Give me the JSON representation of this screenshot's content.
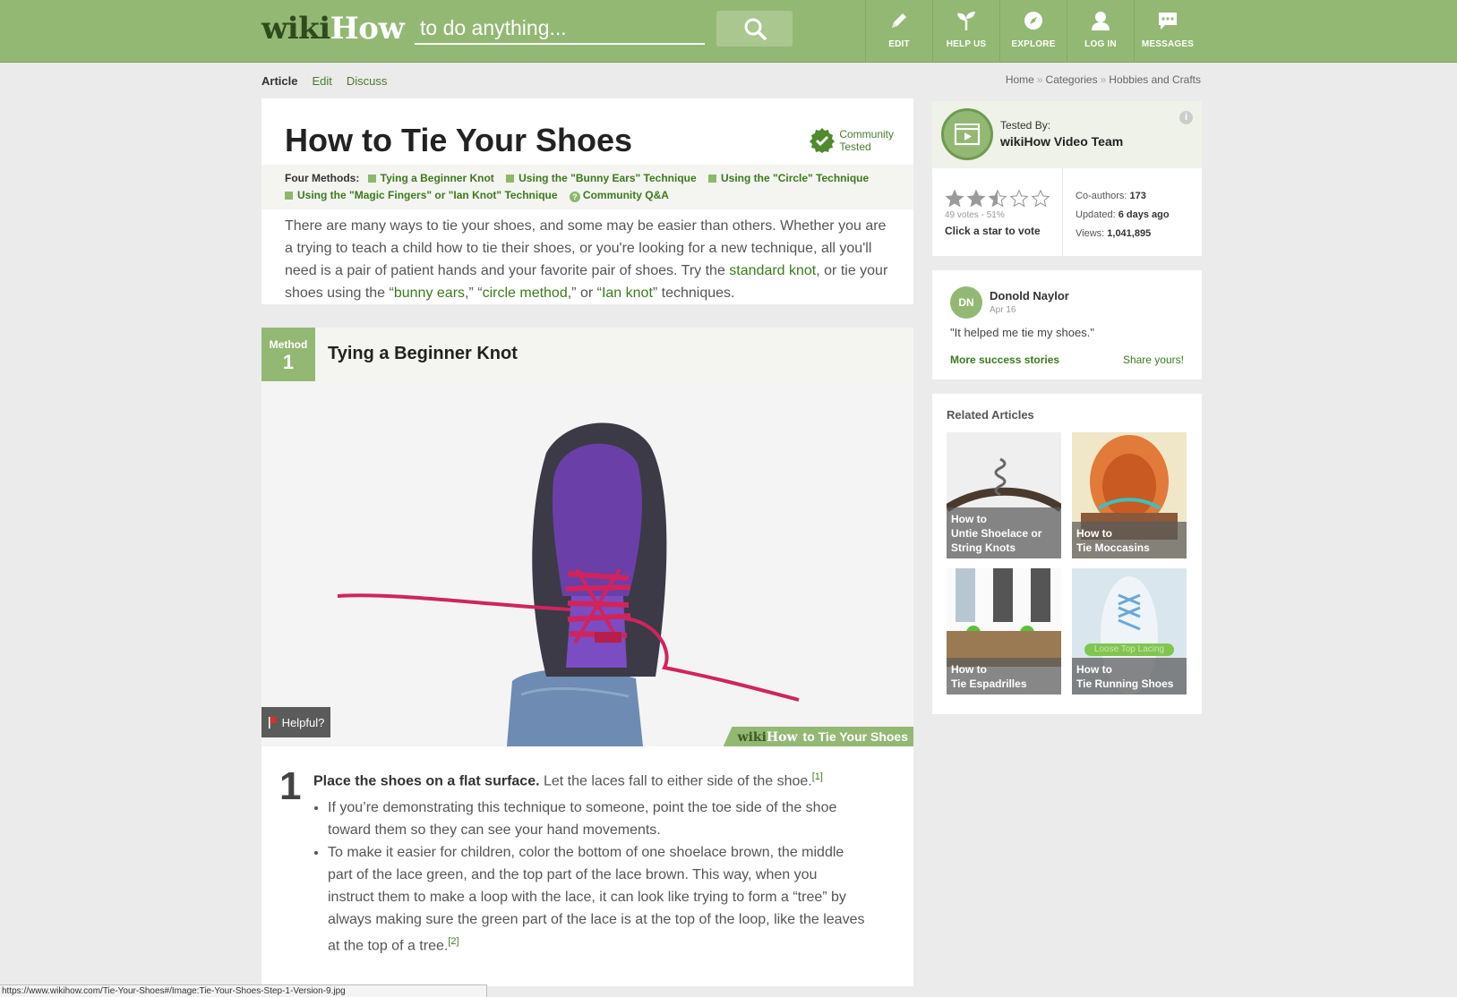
{
  "header": {
    "logo_wiki": "wiki",
    "logo_how": "How",
    "search_placeholder": "to do anything...",
    "nav": [
      {
        "label": "EDIT",
        "icon": "pencil-icon"
      },
      {
        "label": "HELP US",
        "icon": "sprout-icon"
      },
      {
        "label": "EXPLORE",
        "icon": "compass-icon"
      },
      {
        "label": "LOG IN",
        "icon": "user-icon"
      },
      {
        "label": "MESSAGES",
        "icon": "chat-bubble-icon"
      }
    ]
  },
  "tabs": [
    "Article",
    "Edit",
    "Discuss"
  ],
  "breadcrumbs": [
    "Home",
    "Categories",
    "Hobbies and Crafts"
  ],
  "article": {
    "title": "How to Tie Your Shoes",
    "badge_line1": "Community",
    "badge_line2": "Tested",
    "methods_lead": "Four Methods:",
    "methods": [
      "Tying a Beginner Knot",
      "Using the \"Bunny Ears\" Technique",
      "Using the \"Circle\" Technique",
      "Using the \"Magic Fingers\" or \"Ian Knot\" Technique"
    ],
    "community_qa": "Community Q&A",
    "intro_1": "There are many ways to tie your shoes, and some may be easier than others. Whether you are a trying to teach a child how to tie their shoes, or you're looking for a new technique, all you'll need is a pair of patient hands and your favorite pair of shoes. Try the ",
    "intro_link_1": "standard knot",
    "intro_2": ", or tie your shoes using the “",
    "intro_link_2": "bunny ears",
    "intro_3": ",” “",
    "intro_link_3": "circle method",
    "intro_4": ",” or “",
    "intro_link_4": "Ian knot",
    "intro_5": "” techniques."
  },
  "method": {
    "word": "Method",
    "number": "1",
    "title": "Tying a Beginner Knot"
  },
  "step_image": {
    "helpful": "Helpful?",
    "wm_wiki": "wiki",
    "wm_how": "How",
    "wm_title": "to Tie Your Shoes"
  },
  "step": {
    "number": "1",
    "bold": "Place the shoes on a flat surface.",
    "text": " Let the laces fall to either side of the shoe.",
    "ref1": "[1]",
    "bullet1": "If you’re demonstrating this technique to someone, point the toe side of the shoe toward them so they can see your hand movements.",
    "bullet2": "To make it easier for children, color the bottom of one shoelace brown, the middle part of the lace green, and the top part of the lace brown. This way, when you instruct them to make a loop with the lace, it can look like trying to form a “tree” by always making sure the green part of the lace is at the top of the loop, like the leaves at the top of a tree.",
    "ref2": "[2]"
  },
  "sidebar": {
    "tested_by": "Tested By:",
    "tested_team": "wikiHow Video Team",
    "rating": 2.5,
    "votes": "49 votes - 51%",
    "vote_cta": "Click a star to vote",
    "coauthors_label": "Co-authors:",
    "coauthors": "173",
    "updated_label": "Updated:",
    "updated": "6 days ago",
    "views_label": "Views:",
    "views": "1,041,895",
    "story_initials": "DN",
    "story_name": "Donold Naylor",
    "story_date": "Apr 16",
    "story_quote": "\"It helped me tie my shoes.\"",
    "story_more": "More success stories",
    "story_share": "Share yours!",
    "related_title": "Related Articles",
    "related": [
      {
        "l1": "How to",
        "l2": "Untie Shoelace or",
        "l3": "String Knots"
      },
      {
        "l1": "How to",
        "l2": "Tie Moccasins",
        "l3": ""
      },
      {
        "l1": "How to",
        "l2": "Tie Espadrilles",
        "l3": ""
      },
      {
        "l1": "How to",
        "l2": "Tie Running Shoes",
        "l3": ""
      }
    ],
    "related_overlay": "Loose Top Lacing"
  },
  "status_url": "https://www.wikihow.com/Tie-Your-Shoes#/Image:Tie-Your-Shoes-Step-1-Version-9.jpg",
  "colors": {
    "brand": "#93b874",
    "link": "#3c7a1c",
    "lace": "#d0245e"
  }
}
